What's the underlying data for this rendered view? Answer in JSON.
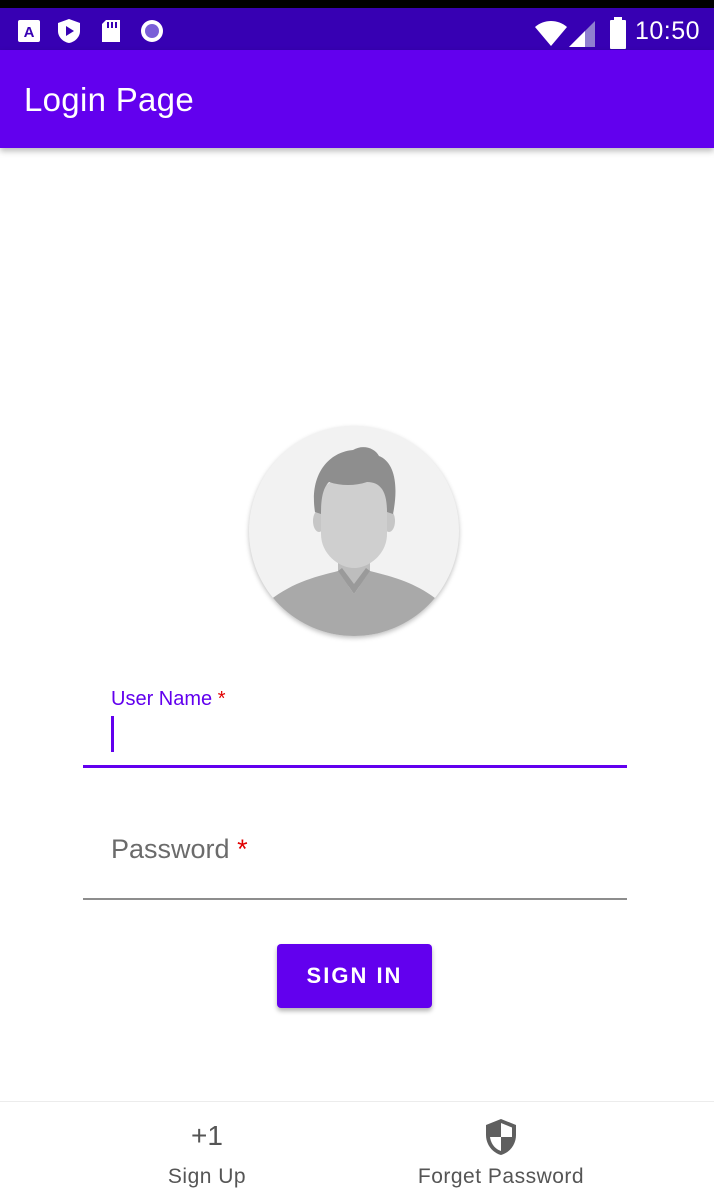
{
  "status_bar": {
    "time": "10:50"
  },
  "app_bar": {
    "title": "Login Page"
  },
  "form": {
    "username": {
      "label": "User Name",
      "required_marker": "*",
      "value": ""
    },
    "password": {
      "label": "Password",
      "required_marker": "*",
      "value": ""
    },
    "submit_label": "SIGN IN"
  },
  "bottom_nav": {
    "items": [
      {
        "label": "Sign Up",
        "icon": "plus-one-icon",
        "icon_text": "+1"
      },
      {
        "label": "Forget Password",
        "icon": "shield-icon"
      }
    ]
  },
  "colors": {
    "primary": "#6200ee",
    "status_bar": "#3700b3",
    "error": "#e00000"
  }
}
